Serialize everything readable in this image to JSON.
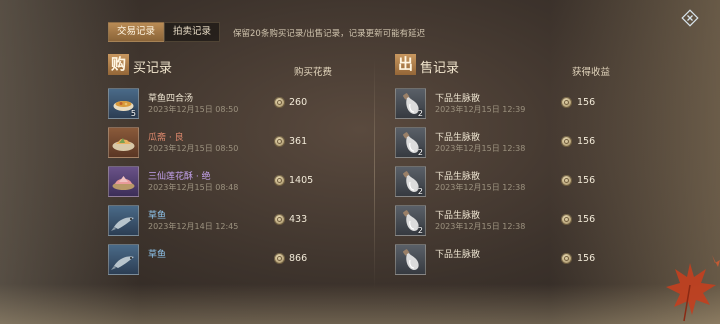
{
  "tabs": [
    {
      "label": "交易记录",
      "active": true
    },
    {
      "label": "拍卖记录",
      "active": false
    }
  ],
  "notice": "保留20条购买记录/出售记录，记录更新可能有延迟",
  "buy": {
    "badge": "购",
    "title": "买记录",
    "column": "购买花费",
    "rows": [
      {
        "name": "草鱼四合汤",
        "time": "2023年12月15日 08:50",
        "amount": "260",
        "qty": "5",
        "quality": "blue",
        "name_color": "#efe6d2",
        "icon": "soup-bowl-icon"
      },
      {
        "name": "瓜斋 · 良",
        "time": "2023年12月15日 08:50",
        "amount": "361",
        "qty": "",
        "quality": "orange",
        "name_color": "#e08a6e",
        "icon": "dish-icon"
      },
      {
        "name": "三仙莲花酥 · 绝",
        "time": "2023年12月15日 08:48",
        "amount": "1405",
        "qty": "",
        "quality": "purple",
        "name_color": "#c3a2ec",
        "icon": "pastry-icon"
      },
      {
        "name": "草鱼",
        "time": "2023年12月14日 12:45",
        "amount": "433",
        "qty": "",
        "quality": "blue",
        "name_color": "#8ec4ec",
        "icon": "fish-icon"
      },
      {
        "name": "草鱼",
        "time": "",
        "amount": "866",
        "qty": "",
        "quality": "blue",
        "name_color": "#8ec4ec",
        "icon": "fish-icon"
      }
    ]
  },
  "sell": {
    "badge": "出",
    "title": "售记录",
    "column": "获得收益",
    "rows": [
      {
        "name": "下品生脉散",
        "time": "2023年12月15日 12:39",
        "amount": "156",
        "qty": "2",
        "quality": "grey",
        "name_color": "#efe6d2",
        "icon": "medicine-bottle-icon"
      },
      {
        "name": "下品生脉散",
        "time": "2023年12月15日 12:38",
        "amount": "156",
        "qty": "2",
        "quality": "grey",
        "name_color": "#efe6d2",
        "icon": "medicine-bottle-icon"
      },
      {
        "name": "下品生脉散",
        "time": "2023年12月15日 12:38",
        "amount": "156",
        "qty": "2",
        "quality": "grey",
        "name_color": "#efe6d2",
        "icon": "medicine-bottle-icon"
      },
      {
        "name": "下品生脉散",
        "time": "2023年12月15日 12:38",
        "amount": "156",
        "qty": "2",
        "quality": "grey",
        "name_color": "#efe6d2",
        "icon": "medicine-bottle-icon"
      },
      {
        "name": "下品生脉散",
        "time": "",
        "amount": "156",
        "qty": "",
        "quality": "grey",
        "name_color": "#efe6d2",
        "icon": "medicine-bottle-icon"
      }
    ]
  },
  "colors": {
    "accent": "#b98b55",
    "background": "#3d332c"
  }
}
